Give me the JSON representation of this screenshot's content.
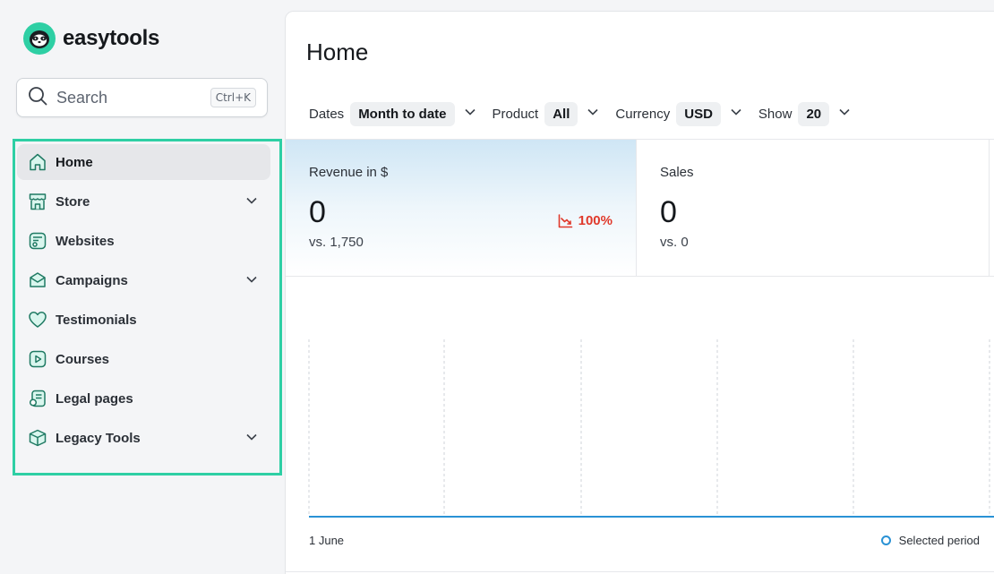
{
  "brand": {
    "name": "easytools",
    "accent": "#2ecfa4"
  },
  "search": {
    "label": "Search",
    "shortcut": "Ctrl+K",
    "icon": "search-icon"
  },
  "sidebar": {
    "items": [
      {
        "label": "Home",
        "icon": "home-icon",
        "active": true,
        "expandable": false
      },
      {
        "label": "Store",
        "icon": "store-icon",
        "active": false,
        "expandable": true
      },
      {
        "label": "Websites",
        "icon": "website-icon",
        "active": false,
        "expandable": false
      },
      {
        "label": "Campaigns",
        "icon": "mail-icon",
        "active": false,
        "expandable": true
      },
      {
        "label": "Testimonials",
        "icon": "heart-icon",
        "active": false,
        "expandable": false
      },
      {
        "label": "Courses",
        "icon": "play-icon",
        "active": false,
        "expandable": false
      },
      {
        "label": "Legal pages",
        "icon": "legal-doc-icon",
        "active": false,
        "expandable": false
      },
      {
        "label": "Legacy Tools",
        "icon": "box-icon",
        "active": false,
        "expandable": true
      }
    ]
  },
  "main": {
    "title": "Home",
    "filters": [
      {
        "label": "Dates",
        "value": "Month to date"
      },
      {
        "label": "Product",
        "value": "All"
      },
      {
        "label": "Currency",
        "value": "USD"
      },
      {
        "label": "Show",
        "value": "20"
      }
    ],
    "stats": {
      "revenue": {
        "label": "Revenue in $",
        "value": "0",
        "compare": "vs. 1,750",
        "delta": "100%",
        "delta_color": "#e0392b"
      },
      "sales": {
        "label": "Sales",
        "value": "0",
        "compare": "vs. 0"
      }
    },
    "chart": {
      "x_start_label": "1 June",
      "legend": "Selected period",
      "line_color": "#2a92d5"
    }
  },
  "chart_data": {
    "type": "line",
    "x": [
      "1 June"
    ],
    "series": [
      {
        "name": "Selected period",
        "values": [
          0
        ]
      }
    ],
    "grid": true,
    "legend_position": "bottom-right"
  }
}
